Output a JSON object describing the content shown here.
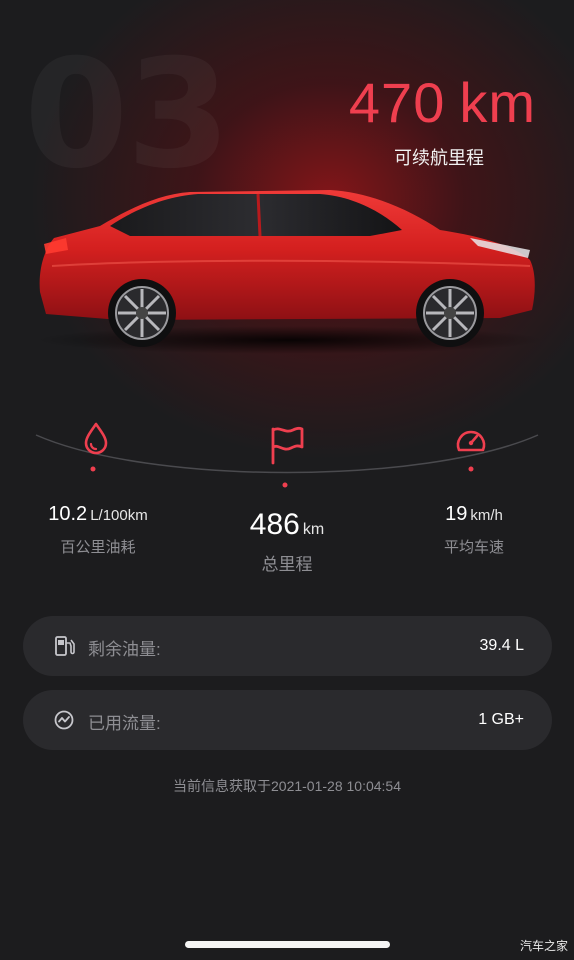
{
  "header": {
    "model_watermark": "03",
    "range_value": "470",
    "range_unit": "km",
    "range_label": "可续航里程"
  },
  "stats": {
    "fuel_consumption": {
      "value": "10.2",
      "unit": "L/100km",
      "label": "百公里油耗",
      "icon": "fuel-drop-icon"
    },
    "total_mileage": {
      "value": "486",
      "unit": "km",
      "label": "总里程",
      "icon": "flag-icon"
    },
    "average_speed": {
      "value": "19",
      "unit": "km/h",
      "label": "平均车速",
      "icon": "speedometer-icon"
    }
  },
  "cards": {
    "remaining_fuel": {
      "label": "剩余油量:",
      "value": "39.4 L",
      "icon": "fuel-pump-icon"
    },
    "data_used": {
      "label": "已用流量:",
      "value": "1 GB+",
      "icon": "data-traffic-icon"
    }
  },
  "footer": {
    "updated_at": "当前信息获取于2021-01-28 10:04:54",
    "site_watermark": "汽车之家"
  },
  "colors": {
    "accent": "#ef3f4f",
    "background": "#1c1c1e",
    "card": "#2a2a2d",
    "car_body": "#d01f22"
  }
}
